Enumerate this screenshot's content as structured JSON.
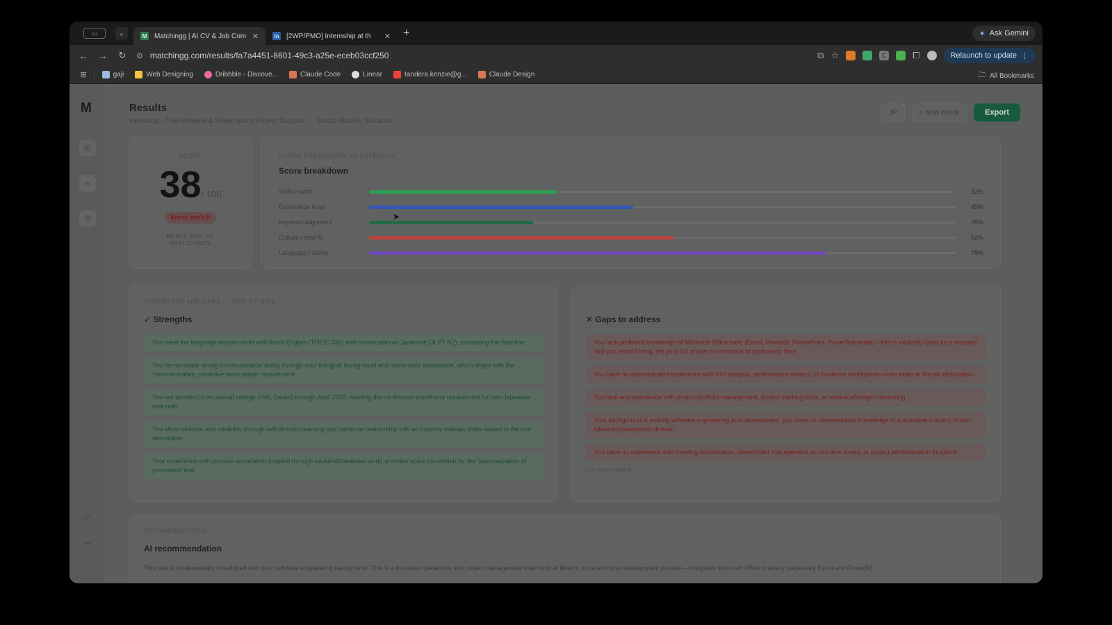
{
  "browser": {
    "tabs": [
      {
        "favicon": "M",
        "title": "Matchingg | AI CV & Job Com",
        "active": true
      },
      {
        "favicon": "in",
        "title": "[2WP/PMO] Internship at th",
        "active": false
      }
    ],
    "gemini_label": "Ask Gemini",
    "url": "matchingg.com/results/fa7a4451-8601-49c3-a25e-eceb03ccf250",
    "relaunch_label": "Relaunch to update",
    "bookmarks": [
      "gaji",
      "Web Designing",
      "Dribbble - Discove...",
      "Claude Code",
      "Linear",
      "tandera.kenzie@g...",
      "Claude Design"
    ],
    "all_bookmarks": "All Bookmarks"
  },
  "app": {
    "logo": "M",
    "rail_bottom_initials": "JP",
    "title": "Results",
    "breadcrumb": [
      "Internship - Two-Wheeler & Powersports Project Support",
      "Bosch Mobility Solutions"
    ],
    "header": {
      "avatar": "JP",
      "new_check": "+ New check",
      "export": "Export"
    },
    "score": {
      "label": "SCORE",
      "value": "38",
      "denominator": "/ 100",
      "verdict": "Weak match",
      "beats": "BEATS 25% OF APPLICANTS"
    },
    "breakdown": {
      "eyebrow": "SCORE BREAKDOWN BY CATEGORY",
      "title": "Score breakdown",
      "rows": [
        {
          "label": "Skills match",
          "pct_text": "32%",
          "value": 32,
          "color": "#2e9e54"
        },
        {
          "label": "Experience level",
          "pct_text": "45%",
          "value": 45,
          "color": "#3357b8"
        },
        {
          "label": "Keyword alignment",
          "pct_text": "28%",
          "value": 28,
          "color": "#1e6b44"
        },
        {
          "label": "Culture / tone fit",
          "pct_text": "52%",
          "value": 52,
          "color": "#b8443d"
        },
        {
          "label": "Language / clarity",
          "pct_text": "78%",
          "value": 78,
          "color": "#7048b8"
        }
      ]
    },
    "strengths": {
      "eyebrow": "STRENGTHS AND GAPS — SIDE BY SIDE",
      "title": "✓ Strengths",
      "items": [
        "You meet the language requirements with fluent English (TOEIC 835) and conversational Japanese (JLPT N2), exceeding the baseline",
        "You demonstrate strong communication ability through your trilingual background and mentorship experience, which aligns with the 'communicative, proactive team player' requirement",
        "You are enrolled in vocational college (HAL Osaka) through April 2028, meeting the continuous enrollment requirement for non-Japanese nationals",
        "You show initiative and reliability through self-directed learning and hands-on mentorship with an industry veteran, traits valued in the role description",
        "Your experience with process automation (implied through backend/database work) provides some foundation for the 'automatization of processes' task"
      ]
    },
    "gaps": {
      "title": "✕ Gaps to address",
      "items": [
        "You lack profound knowledge of Microsoft Office tools (Excel, PowerBI, PowerPoint, PowerAutomate)—this is explicitly listed as a required skill you should bring, yet your CV shows no evidence of proficiency here",
        "You have no demonstrated experience with KPI analysis, performance metrics, or business intelligence—core tasks in the job description",
        "You lack any experience with project portfolio management, project tracking tools, or resource/budget monitoring",
        "Your background is entirely software engineering and development; you have no demonstrated knowledge of automotive industry or two-wheeler/powersports domain",
        "You have no experience with meeting coordination, stakeholder management across time zones, or project administration functions"
      ],
      "more": "+ 3 more (expand)"
    },
    "recommendation": {
      "eyebrow": "RECOMMENDATION",
      "title": "AI recommendation",
      "text": "This role is fundamentally misaligned with your software engineering background. This is a business operations and project management internship at Bosch, not a technical development position—it requires Microsoft Office mastery (especially Excel and PowerBI),"
    }
  }
}
